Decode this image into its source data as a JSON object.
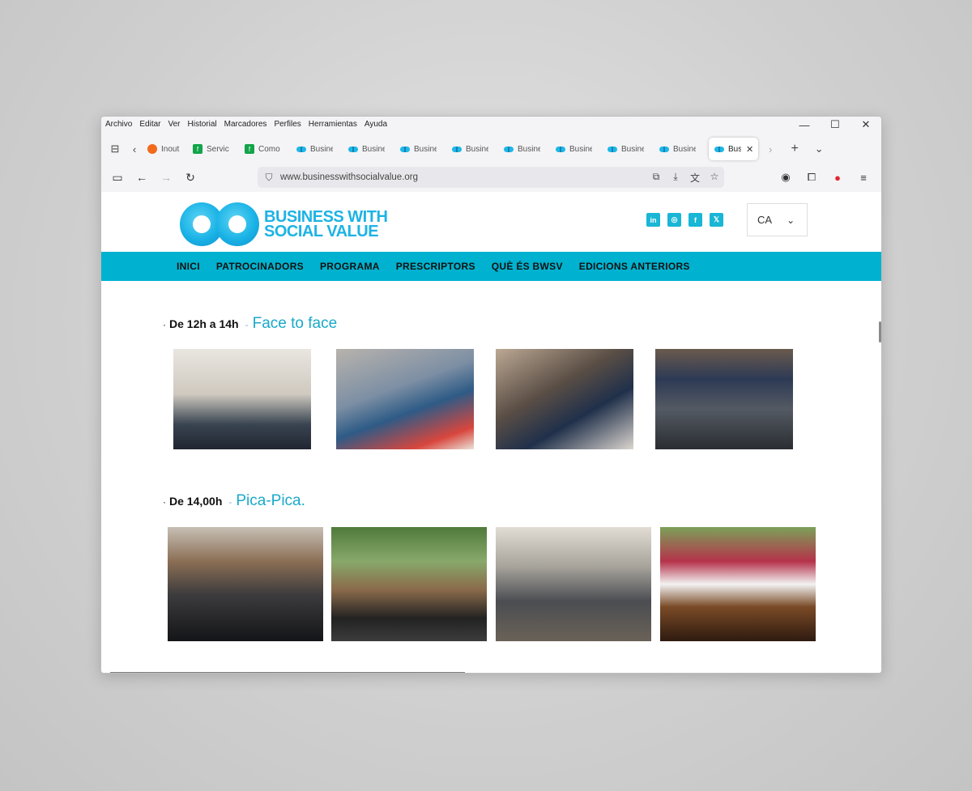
{
  "menu": [
    "Archivo",
    "Editar",
    "Ver",
    "Historial",
    "Marcadores",
    "Perfiles",
    "Herramientas",
    "Ayuda"
  ],
  "tabs": [
    {
      "label": "Inout",
      "fav": "orange"
    },
    {
      "label": "Servic",
      "fav": "green"
    },
    {
      "label": "Como",
      "fav": "green"
    },
    {
      "label": "Busine",
      "fav": "bw"
    },
    {
      "label": "Busine",
      "fav": "bw"
    },
    {
      "label": "Busine",
      "fav": "bw"
    },
    {
      "label": "Busine",
      "fav": "bw"
    },
    {
      "label": "Busine",
      "fav": "bw"
    },
    {
      "label": "Busine",
      "fav": "bw"
    },
    {
      "label": "Busine",
      "fav": "bw"
    },
    {
      "label": "Busine",
      "fav": "bw"
    }
  ],
  "active_tab": {
    "label": "Bus"
  },
  "url": "www.businesswithsocialvalue.org",
  "logo": {
    "line1": "BUSINESS WITH",
    "line2": "SOCIAL VALUE"
  },
  "socials": [
    "in",
    "◎",
    "f",
    "𝕏"
  ],
  "lang": {
    "code": "CA"
  },
  "nav": [
    "INICI",
    "PATROCINADORS",
    "PROGRAMA",
    "PRESCRIPTORS",
    "QUÈ ÉS BWSV",
    "EDICIONS ANTERIORS"
  ],
  "sections": [
    {
      "dot": "·",
      "time": "De 12h a 14h",
      "sep": "-",
      "label": "Face to face"
    },
    {
      "dot": "·",
      "time": "De 14,00h",
      "sep": "-",
      "label": "Pica-Pica."
    }
  ],
  "colors": {
    "accent": "#00b2cf",
    "brand": "#1db3e4",
    "title_blue": "#19a9c9"
  }
}
